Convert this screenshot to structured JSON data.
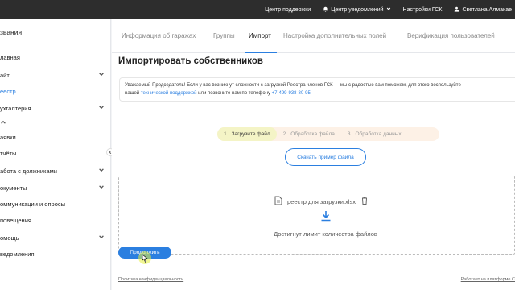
{
  "topbar": {
    "support": "Центр поддержки",
    "notifications": "Центр уведомлений",
    "settings": "Настройки ГСК",
    "user": "Светлана Алмакае"
  },
  "sidebar": {
    "org_name": "звания",
    "items": [
      {
        "label": "лавная"
      },
      {
        "label": "айт"
      },
      {
        "label": "еестр"
      },
      {
        "label": "ухгалтерия"
      },
      {
        "label": "аявки"
      },
      {
        "label": "тчёты"
      },
      {
        "label": "абота с должниками"
      },
      {
        "label": "окументы"
      },
      {
        "label": "оммуникации и опросы"
      },
      {
        "label": "повещения"
      },
      {
        "label": "омощь"
      },
      {
        "label": "ведомления"
      }
    ]
  },
  "tabs": [
    {
      "label": "Информация об гаражах"
    },
    {
      "label": "Группы"
    },
    {
      "label": "Импорт"
    },
    {
      "label": "Настройка дополнительных полей"
    },
    {
      "label": "Верификация пользователей"
    }
  ],
  "page": {
    "title": "Импортировать собственников",
    "notice_line1": "Уважаемый Председатель! Если у вас возникнут сложности с загрузкой Реестра членов ГСК — мы с радостью вам поможем, для этого воспользуйте",
    "notice_line2_start": "нашей",
    "notice_link": "технической поддержкой",
    "notice_line2_mid": "или позвоните нам по телефону",
    "notice_phone": "+7-499-938-80-95",
    "notice_line2_end": ".",
    "steps": [
      {
        "num": "1",
        "label": "Загрузите файл"
      },
      {
        "num": "2",
        "label": "Обработка файла"
      },
      {
        "num": "3",
        "label": "Обработка данных"
      }
    ],
    "sample_button": "Скачать пример файла",
    "file_name": "реестр для загрузки.xlsx",
    "limit_text": "Достигнут лимит количества файлов",
    "continue_button": "Продолжить"
  },
  "footer": {
    "privacy": "Политика конфиденциальности",
    "platform": "Работает на платформе С"
  },
  "colors": {
    "accent": "#2b7fe0",
    "topbar": "#2d2d2d",
    "step_active": "#f4f4c6",
    "stepper_bg": "#fdf1e6"
  }
}
